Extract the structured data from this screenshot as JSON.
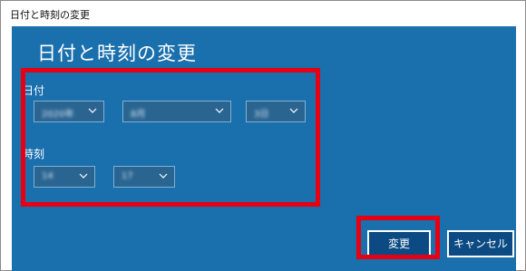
{
  "window": {
    "title": "日付と時刻の変更"
  },
  "dialog": {
    "heading": "日付と時刻の変更",
    "date_section": {
      "label": "日付",
      "year": "2020年",
      "month": "8月",
      "day": "3日"
    },
    "time_section": {
      "label": "時刻",
      "hour": "14",
      "minute": "17"
    },
    "buttons": {
      "change_label": "変更",
      "cancel_label": "キャンセル"
    }
  },
  "colors": {
    "background": "#1a6fad",
    "highlight": "#e60012",
    "button": "#0b4a82"
  },
  "icons": {
    "dropdown_chevron": "chevron-down-icon"
  }
}
